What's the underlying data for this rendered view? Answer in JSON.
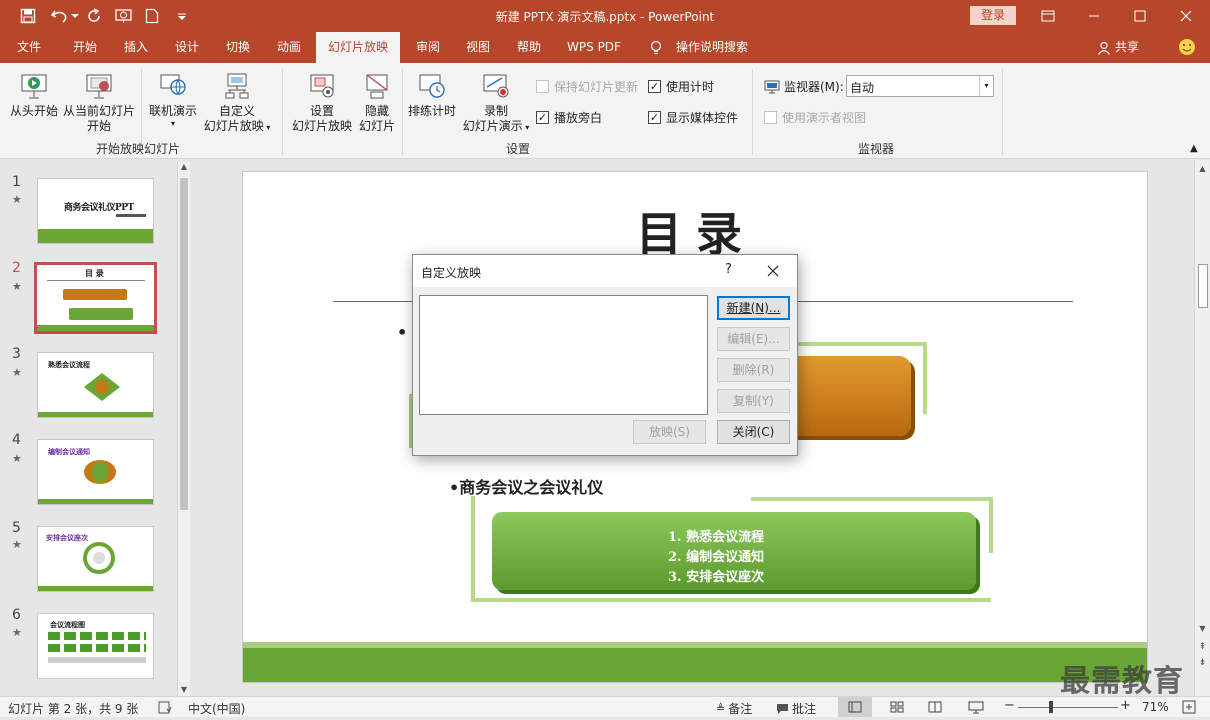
{
  "window": {
    "title": "新建 PPTX 演示文稿.pptx  -  PowerPoint",
    "login_label": "登录"
  },
  "tabs": [
    {
      "label": "文件"
    },
    {
      "label": "开始"
    },
    {
      "label": "插入"
    },
    {
      "label": "设计"
    },
    {
      "label": "切换"
    },
    {
      "label": "动画"
    },
    {
      "label": "幻灯片放映"
    },
    {
      "label": "审阅"
    },
    {
      "label": "视图"
    },
    {
      "label": "帮助"
    },
    {
      "label": "WPS PDF"
    },
    {
      "label": "操作说明搜索"
    }
  ],
  "share_label": "共享",
  "ribbon": {
    "from_start": "从头开始",
    "from_current_1": "从当前幻灯片",
    "from_current_2": "开始",
    "online_present": "联机演示",
    "custom_1": "自定义",
    "custom_2": "幻灯片放映",
    "group1": "开始放映幻灯片",
    "setup_1": "设置",
    "setup_2": "幻灯片放映",
    "hide_1": "隐藏",
    "hide_2": "幻灯片",
    "rehearse": "排练计时",
    "record_1": "录制",
    "record_2": "幻灯片演示",
    "keep_updated": "保持幻灯片更新",
    "play_narration": "播放旁白",
    "use_timings": "使用计时",
    "show_media": "显示媒体控件",
    "group2": "设置",
    "monitor_label": "监视器(M):",
    "monitor_value": "自动",
    "presenter_view": "使用演示者视图",
    "group3": "监视器"
  },
  "thumbnails": [
    {
      "num": "1",
      "star": "★",
      "title": "商务会议礼仪PPT"
    },
    {
      "num": "2",
      "star": "★",
      "title": "目 录"
    },
    {
      "num": "3",
      "star": "★",
      "title": "熟悉会议流程"
    },
    {
      "num": "4",
      "star": "★",
      "title": "编制会议通知"
    },
    {
      "num": "5",
      "star": "★",
      "title": "安排会议座次"
    },
    {
      "num": "6",
      "star": "★",
      "title": "会议流程图"
    }
  ],
  "slide": {
    "title": "目录",
    "bullet1": "•商务会议之会议礼仪",
    "items": [
      "1.  熟悉会议流程",
      "2.  编制会议通知",
      "3.  安排会议座次"
    ]
  },
  "dialog": {
    "title": "自定义放映",
    "help": "?",
    "new": "新建(N)...",
    "edit": "编辑(E)...",
    "delete": "删除(R)",
    "copy": "复制(Y)",
    "show": "放映(S)",
    "close": "关闭(C)"
  },
  "status": {
    "slide_info": "幻灯片 第 2 张，共 9 张",
    "language": "中文(中国)",
    "notes": "备注",
    "comments": "批注",
    "zoom": "71%"
  },
  "watermark": "最需教育",
  "colors": {
    "accent": "#b7472a",
    "green": "#6aa636",
    "orange": "#c17a16"
  }
}
